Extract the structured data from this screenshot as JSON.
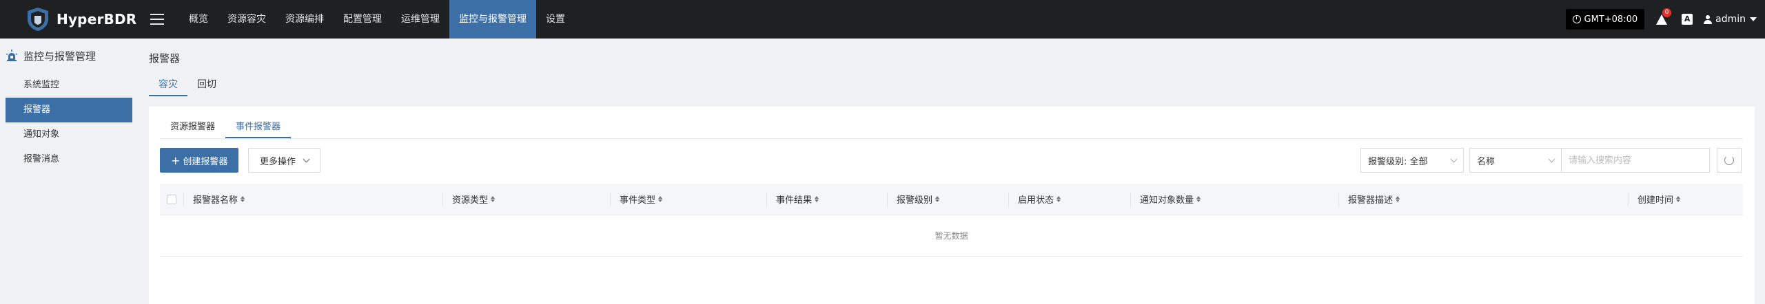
{
  "app": {
    "name": "HyperBDR"
  },
  "nav": [
    "概览",
    "资源容灾",
    "资源编排",
    "配置管理",
    "运维管理",
    "监控与报警管理",
    "设置"
  ],
  "topbar": {
    "timezone": "GMT+08:00",
    "alert_count": "0",
    "lang_icon": "A",
    "user": "admin"
  },
  "sidebar": {
    "title": "监控与报警管理",
    "items": [
      "系统监控",
      "报警器",
      "通知对象",
      "报警消息"
    ]
  },
  "page": {
    "title": "报警器",
    "tabs": [
      "容灾",
      "回切"
    ],
    "subtabs": [
      "资源报警器",
      "事件报警器"
    ],
    "create_button": "创建报警器",
    "more_button": "更多操作",
    "level_filter": "报警级别: 全部",
    "field_select": "名称",
    "search_placeholder": "请输入搜索内容",
    "columns": [
      "报警器名称",
      "资源类型",
      "事件类型",
      "事件结果",
      "报警级别",
      "启用状态",
      "通知对象数量",
      "报警器描述",
      "创建时间"
    ],
    "empty_text": "暂无数据"
  },
  "colors": {
    "accent": "#3d6fa7",
    "topbar": "#1f2022",
    "badge": "#e0302b"
  }
}
